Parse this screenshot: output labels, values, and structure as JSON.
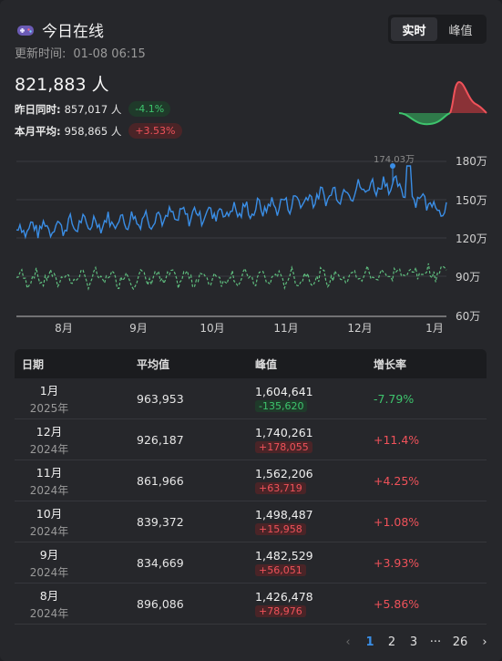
{
  "header": {
    "icon": "gamepad-icon",
    "title": "今日在线",
    "tabs": [
      {
        "label": "实时",
        "active": true
      },
      {
        "label": "峰值",
        "active": false
      }
    ],
    "update_label": "更新时间:",
    "update_time": "01-08 06:15"
  },
  "summary": {
    "current": "821,883 人",
    "rows": [
      {
        "label": "昨日同时:",
        "value": "857,017 人",
        "change": "-4.1%",
        "trend": "down"
      },
      {
        "label": "本月平均:",
        "value": "958,865 人",
        "change": "+3.53%",
        "trend": "up"
      }
    ]
  },
  "chart_data": {
    "type": "line",
    "x_labels": [
      "8月",
      "9月",
      "10月",
      "11月",
      "12月",
      "1月"
    ],
    "y_ticks": [
      "180万",
      "150万",
      "120万",
      "90万",
      "60万"
    ],
    "ylim": [
      60,
      180
    ],
    "peak_annotation": "174.03万",
    "series": [],
    "colors": {
      "peak_line": "#3a8ee6",
      "avg_line": "#5fbf7f",
      "grid": "#3a3b40"
    }
  },
  "table": {
    "headers": [
      "日期",
      "平均值",
      "峰值",
      "增长率"
    ],
    "rows": [
      {
        "month": "1月",
        "year": "2025年",
        "avg": "963,953",
        "peak": "1,604,641",
        "peak_delta": "-135,620",
        "delta_trend": "down",
        "growth": "-7.79%",
        "growth_trend": "down"
      },
      {
        "month": "12月",
        "year": "2024年",
        "avg": "926,187",
        "peak": "1,740,261",
        "peak_delta": "+178,055",
        "delta_trend": "up",
        "growth": "+11.4%",
        "growth_trend": "up"
      },
      {
        "month": "11月",
        "year": "2024年",
        "avg": "861,966",
        "peak": "1,562,206",
        "peak_delta": "+63,719",
        "delta_trend": "up",
        "growth": "+4.25%",
        "growth_trend": "up"
      },
      {
        "month": "10月",
        "year": "2024年",
        "avg": "839,372",
        "peak": "1,498,487",
        "peak_delta": "+15,958",
        "delta_trend": "up",
        "growth": "+1.08%",
        "growth_trend": "up"
      },
      {
        "month": "9月",
        "year": "2024年",
        "avg": "834,669",
        "peak": "1,482,529",
        "peak_delta": "+56,051",
        "delta_trend": "up",
        "growth": "+3.93%",
        "growth_trend": "up"
      },
      {
        "month": "8月",
        "year": "2024年",
        "avg": "896,086",
        "peak": "1,426,478",
        "peak_delta": "+78,976",
        "delta_trend": "up",
        "growth": "+5.86%",
        "growth_trend": "up"
      }
    ]
  },
  "pagination": {
    "prev": "‹",
    "pages": [
      "1",
      "2",
      "3",
      "···",
      "26"
    ],
    "current": "1",
    "next": "›"
  }
}
